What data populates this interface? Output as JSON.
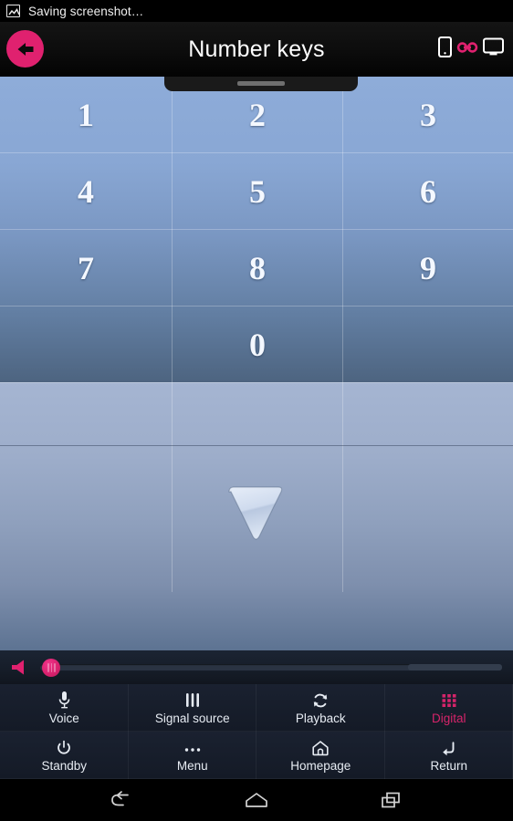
{
  "statusbar": {
    "icon": "image-icon",
    "text": "Saving screenshot…"
  },
  "titlebar": {
    "back_label": "back-arrow-icon",
    "title": "Number keys",
    "phone_icon": "phone-icon",
    "link_icon": "link-icon",
    "tv_icon": "tv-icon",
    "accent_color": "#e0216f"
  },
  "remote": {
    "pull_tab_label": "panel-drag-handle",
    "keys": [
      {
        "label": "1"
      },
      {
        "label": "2"
      },
      {
        "label": "3"
      },
      {
        "label": "4"
      },
      {
        "label": "5"
      },
      {
        "label": "6"
      },
      {
        "label": "7"
      },
      {
        "label": "8"
      },
      {
        "label": "9"
      },
      {
        "label": "0"
      }
    ],
    "down_arrow": "down-triangle-icon"
  },
  "volume": {
    "icon": "volume-icon",
    "value_percent": 1,
    "track_color": "#2a3342",
    "thumb_color": "#d8216d"
  },
  "buttons": [
    {
      "icon": "microphone-icon",
      "label": "Voice",
      "active": false
    },
    {
      "icon": "signal-bars-icon",
      "label": "Signal source",
      "active": false
    },
    {
      "icon": "refresh-icon",
      "label": "Playback",
      "active": false
    },
    {
      "icon": "grid-icon",
      "label": "Digital",
      "active": true
    },
    {
      "icon": "power-icon",
      "label": "Standby",
      "active": false
    },
    {
      "icon": "dots-icon",
      "label": "Menu",
      "active": false
    },
    {
      "icon": "home-icon",
      "label": "Homepage",
      "active": false
    },
    {
      "icon": "return-arrow-icon",
      "label": "Return",
      "active": false
    }
  ],
  "navbar": [
    {
      "icon": "android-back-icon"
    },
    {
      "icon": "android-home-icon"
    },
    {
      "icon": "android-recents-icon"
    }
  ],
  "colors": {
    "accent_pink": "#d6246a",
    "pad_top": "#8eacd9",
    "pad_bottom": "#4d6480",
    "toolbar_bg": "#141a24"
  }
}
